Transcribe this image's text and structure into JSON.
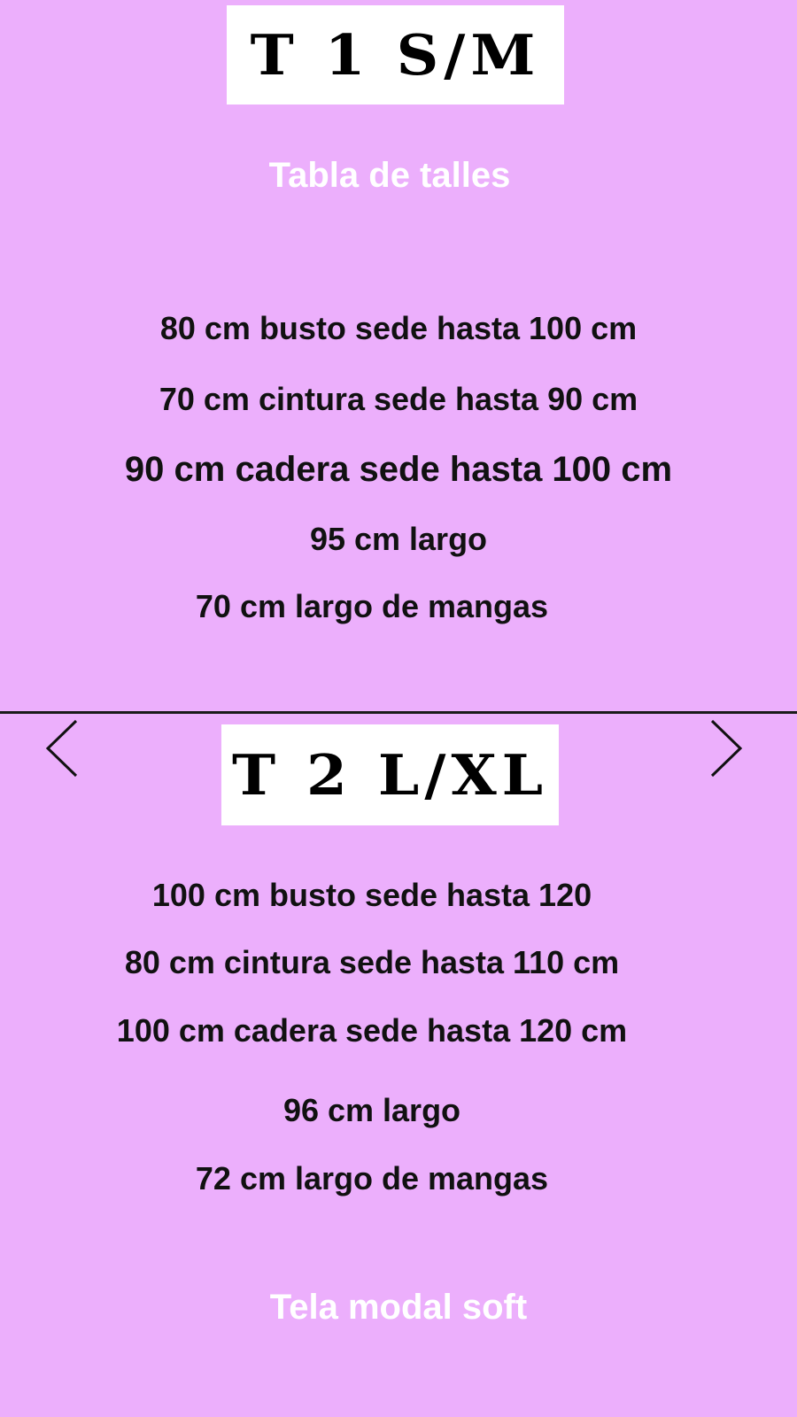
{
  "size1": {
    "label": "T 1 S/M",
    "heading": "Tabla de talles",
    "lines": [
      "80 cm busto sede hasta 100 cm",
      "70 cm cintura sede hasta 90 cm",
      "90 cm cadera sede hasta 100 cm",
      "95 cm largo",
      "70 cm largo de mangas"
    ]
  },
  "size2": {
    "label": "T 2 L/XL",
    "lines": [
      "100 cm busto sede hasta 120",
      "80 cm cintura sede hasta 110 cm",
      "100 cm cadera sede hasta 120 cm",
      "96 cm largo",
      "72 cm largo de mangas"
    ]
  },
  "footer": {
    "fabric": "Tela modal soft"
  },
  "nav": {
    "prev_icon": "chevron-left-icon",
    "next_icon": "chevron-right-icon"
  },
  "colors": {
    "background": "#ecaffc",
    "heading": "#ffffff",
    "text": "#111111",
    "label_box": "#ffffff"
  }
}
